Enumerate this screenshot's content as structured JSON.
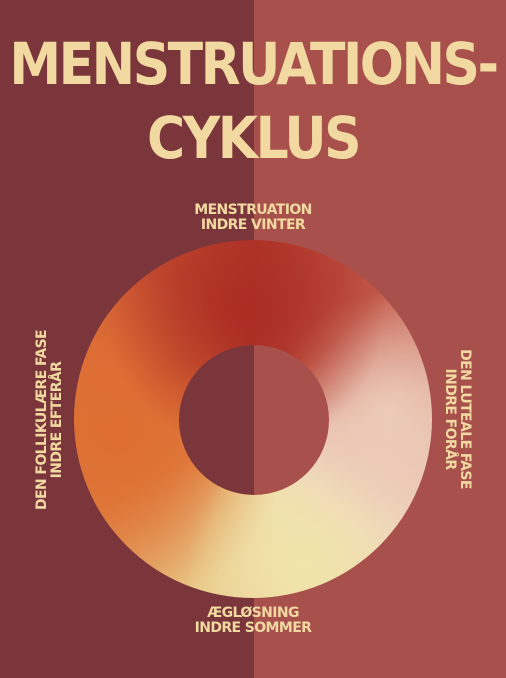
{
  "title": {
    "line1": "MENSTRUATIONS-",
    "line2": "CYKLUS"
  },
  "phases": {
    "top": {
      "line1": "MENSTRUATION",
      "line2": "INDRE VINTER"
    },
    "right": {
      "line1": "DEN LUTEALE FASE",
      "line2": "INDRE FORÅR"
    },
    "bottom": {
      "line1": "ÆGLØSNING",
      "line2": "INDRE SOMMER"
    },
    "left": {
      "line1": "DEN FOLLIKULÆRE FASE",
      "line2": "INDRE EFTERÅR"
    }
  },
  "colors": {
    "background_left": "#7a363b",
    "background_right": "#a8514c",
    "text": "#f1d9a1",
    "winter": "#b33a2c",
    "spring": "#efd8c0",
    "summer": "#efdfb0",
    "autumn": "#dd6d38"
  }
}
